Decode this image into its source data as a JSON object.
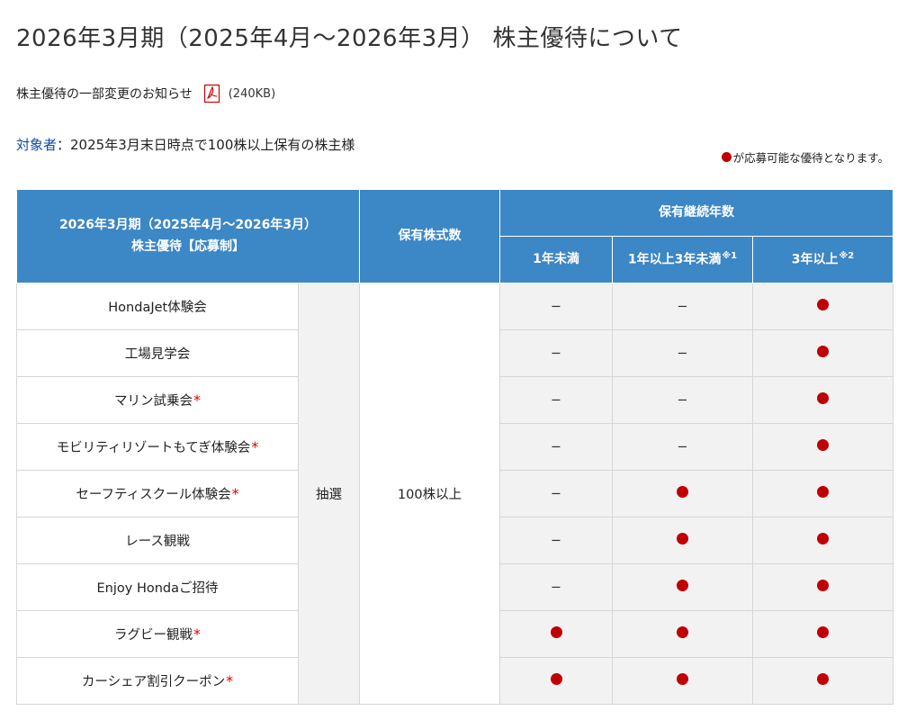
{
  "page": {
    "title": "2026年3月期（2025年4月〜2026年3月） 株主優待について",
    "notice_text": "株主優待の一部変更のお知らせ",
    "notice_size": "(240KB)",
    "target_label": "対象者",
    "target_text": "：2025年3月末日時点で100株以上保有の株主様",
    "legend_text": "が応募可能な優待となります。"
  },
  "table": {
    "head_left_line1": "2026年3月期（2025年4月〜2026年3月）",
    "head_left_line2": "株主優待【応募制】",
    "head_shares": "保有株式数",
    "head_years": "保有継続年数",
    "col1": "1年未満",
    "col2": "1年以上3年未満",
    "col2_note": "※1",
    "col3": "3年以上",
    "col3_note": "※2",
    "method": "抽選",
    "shares": "100株以上",
    "dash": "−",
    "rows": [
      {
        "name": "HondaJet体験会",
        "ast": "",
        "c1": false,
        "c2": false,
        "c3": true
      },
      {
        "name": "工場見学会",
        "ast": "",
        "c1": false,
        "c2": false,
        "c3": true
      },
      {
        "name": "マリン試乗会",
        "ast": "*",
        "c1": false,
        "c2": false,
        "c3": true
      },
      {
        "name": "モビリティリゾートもてぎ体験会",
        "ast": "*",
        "c1": false,
        "c2": false,
        "c3": true
      },
      {
        "name": "セーフティスクール体験会",
        "ast": "*",
        "c1": false,
        "c2": true,
        "c3": true
      },
      {
        "name": "レース観戦",
        "ast": "",
        "c1": false,
        "c2": true,
        "c3": true
      },
      {
        "name": "Enjoy Hondaご招待",
        "ast": "",
        "c1": false,
        "c2": true,
        "c3": true
      },
      {
        "name": "ラグビー観戦",
        "ast": "*",
        "c1": true,
        "c2": true,
        "c3": true
      },
      {
        "name": "カーシェア割引クーポン",
        "ast": "*",
        "c1": true,
        "c2": true,
        "c3": true
      }
    ]
  },
  "colors": {
    "header_blue": "#3c87c5",
    "dot_red": "#c00000",
    "label_blue": "#0b4aa8",
    "cell_gray": "#f2f2f2"
  },
  "icons": {
    "pdf": "pdf-icon",
    "dot": "available-dot-icon"
  }
}
